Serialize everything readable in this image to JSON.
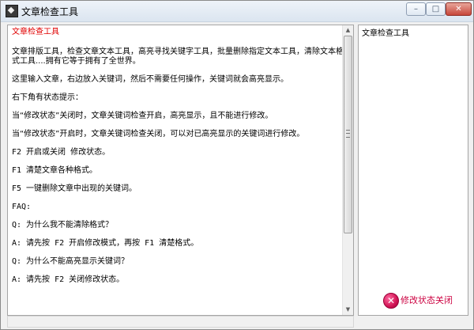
{
  "window": {
    "title": "文章检查工具",
    "controls": {
      "minimize": "–",
      "maximize": "□",
      "close": "✕"
    }
  },
  "editor": {
    "lines": [
      "文章检查工具",
      "文章排版工具，检查文章文本工具，高亮寻找关键字工具，批量删除指定文本工具，清除文本格式工具....拥有它等于拥有了全世界。",
      "这里输入文章，右边放入关键词，然后不需要任何操作，关键词就会高亮显示。",
      "右下角有状态提示：",
      "当“修改状态”关闭时，文章关键词检查开启，高亮显示，且不能进行修改。",
      "当“修改状态”开启时，文章关键词检查关闭，可以对已高亮显示的关键词进行修改。",
      "F2 开启或关闭 修改状态。",
      "F1 清楚文章各种格式。",
      "F5 一键删除文章中出现的关键词。",
      "FAQ:",
      "Q: 为什么我不能清除格式？",
      "A: 请先按 F2 开启修改模式，再按 F1 清楚格式。",
      "Q: 为什么不能高亮显示关键词？",
      "A: 请先按 F2 关闭修改状态。"
    ],
    "heading_color": "#e00000"
  },
  "keywords_panel": {
    "text": "文章检查工具"
  },
  "status": {
    "label": "修改状态关闭",
    "icon": "close-x-icon",
    "icon_glyph": "✕",
    "color": "#cc0040"
  }
}
